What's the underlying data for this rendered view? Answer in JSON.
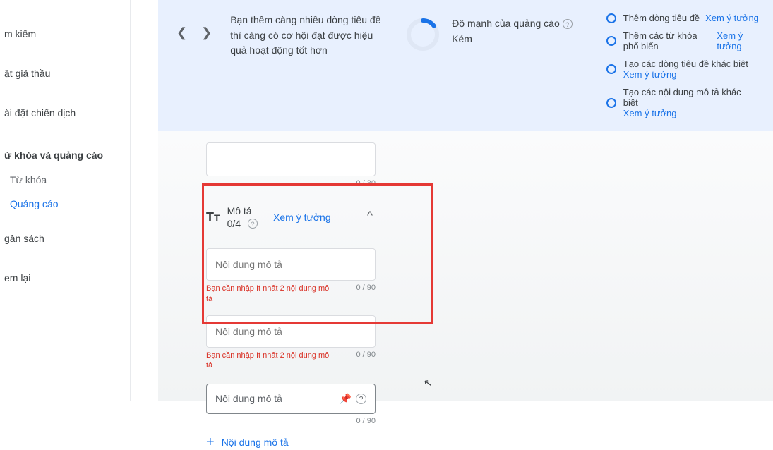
{
  "sidebar": {
    "items": [
      "m kiếm",
      "ặt giá thầu",
      "ài đặt chiến dịch"
    ],
    "group": "ừ khóa và quảng cáo",
    "subs": [
      "Từ khóa",
      "Quảng cáo"
    ],
    "after": [
      "gân sách",
      "em lại"
    ]
  },
  "hint": {
    "text": "Bạn thêm càng nhiều dòng tiêu đề thì càng có cơ hội đạt được hiệu quả hoạt động tốt hơn"
  },
  "strength": {
    "title": "Độ mạnh của quảng cáo",
    "value": "Kém"
  },
  "suggestions": [
    {
      "text": "Thêm dòng tiêu đề",
      "link": "Xem ý tưởng",
      "inline": true
    },
    {
      "text": "Thêm các từ khóa phổ biến",
      "link": "Xem ý tưởng",
      "inline": true
    },
    {
      "text": "Tạo các dòng tiêu đề khác biệt",
      "link": "Xem ý tưởng",
      "inline": false
    },
    {
      "text": "Tạo các nội dung mô tả khác biệt",
      "link": "Xem ý tưởng",
      "inline": false
    }
  ],
  "headline_counter": "0 / 30",
  "desc_section": {
    "label_top": "Mô tả",
    "label_count": "0/4",
    "idea": "Xem ý tưởng"
  },
  "inputs": {
    "placeholder": "Nội dung mô tả",
    "error": "Bạn cần nhập ít nhất 2 nội dung mô tả",
    "counter": "0 / 90"
  },
  "third": {
    "label": "Nội dung mô tả"
  },
  "add": {
    "label": "Nội dung mô tả"
  }
}
